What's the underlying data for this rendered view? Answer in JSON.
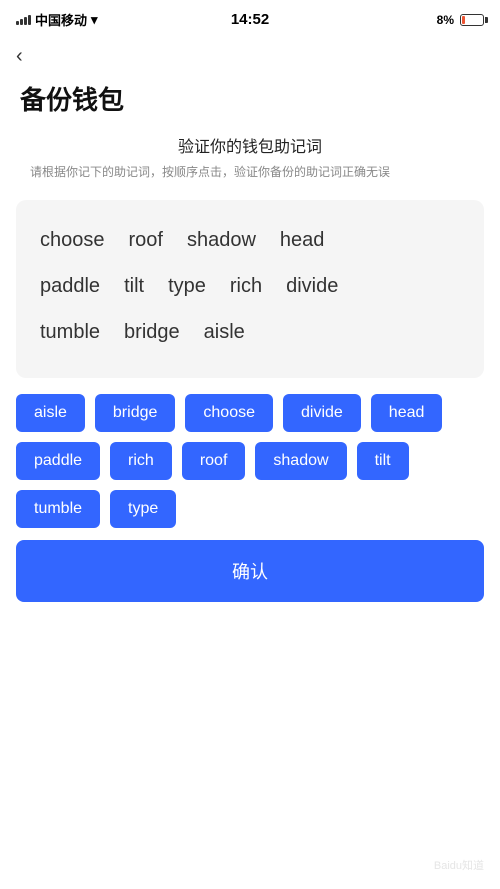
{
  "statusBar": {
    "carrier": "中国移动",
    "time": "14:52",
    "battery_pct": "8%"
  },
  "backLabel": "‹",
  "pageTitle": "备份钱包",
  "subtitleMain": "验证你的钱包助记词",
  "subtitleDesc": "请根据你记下的助记词，按顺序点击，验证你备份的助记词正确无误",
  "displayWords": [
    [
      "choose",
      "roof",
      "shadow",
      "head"
    ],
    [
      "paddle",
      "tilt",
      "type",
      "rich",
      "divide"
    ],
    [
      "tumble",
      "bridge",
      "aisle"
    ]
  ],
  "chips": [
    "aisle",
    "bridge",
    "choose",
    "divide",
    "head",
    "paddle",
    "rich",
    "roof",
    "shadow",
    "tilt",
    "tumble",
    "type"
  ],
  "confirmLabel": "确认",
  "watermark": "Baidu知道"
}
